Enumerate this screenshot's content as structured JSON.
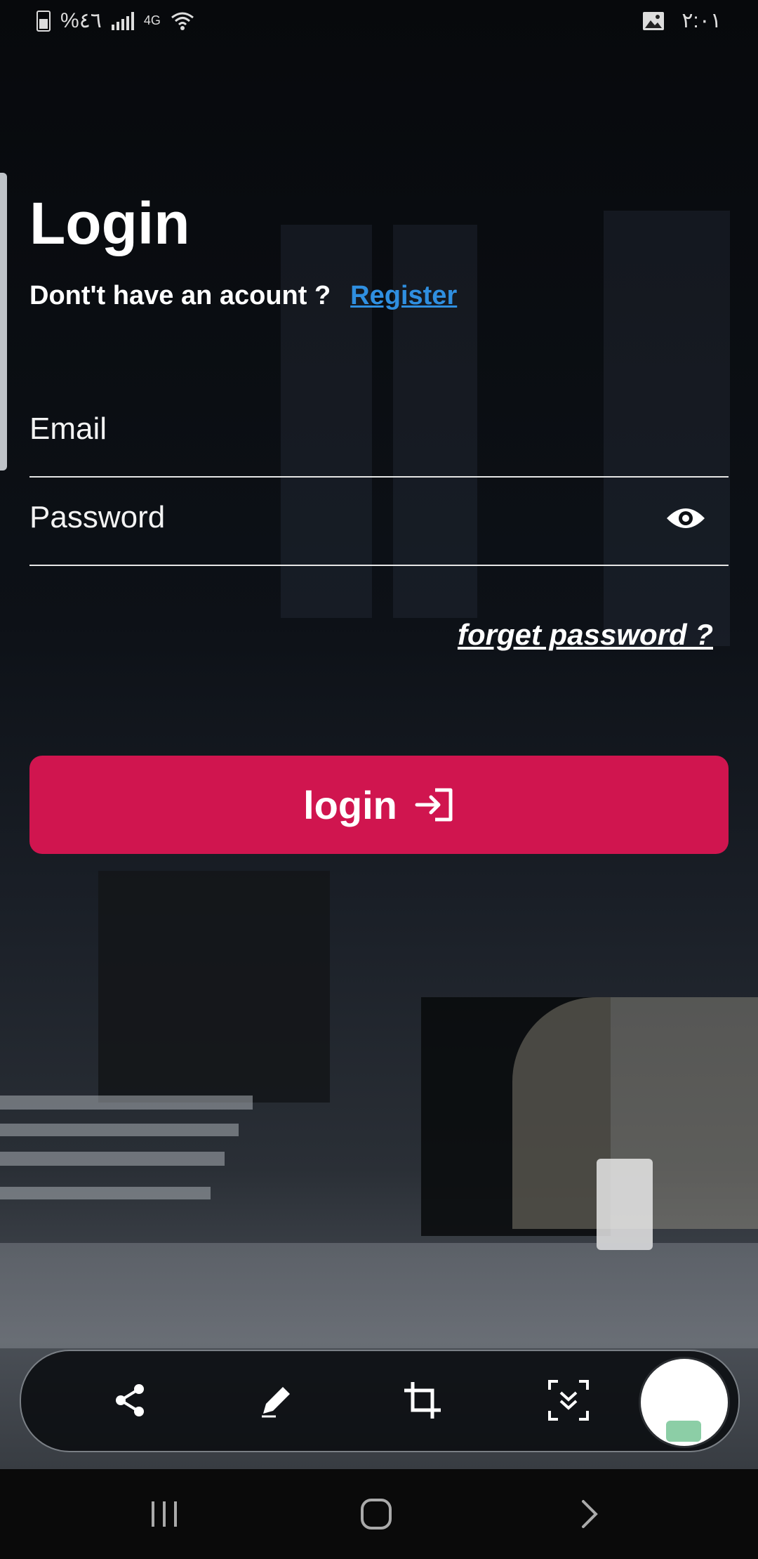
{
  "status_bar": {
    "battery_percent": "%٤٦",
    "network_label": "4G",
    "time": "٢:٠١",
    "icons": [
      "battery-icon",
      "signal-icon",
      "wifi-icon",
      "gallery-icon"
    ]
  },
  "login": {
    "title": "Login",
    "signup_prompt": "Dont't have an acount ?",
    "register_link": "Register",
    "email_placeholder": "Email",
    "password_placeholder": "Password",
    "forgot_link": "forget password ?",
    "login_button": "login",
    "login_icon": "login-arrow-icon"
  },
  "colors": {
    "accent": "#d0154f",
    "link": "#2f8fe0"
  },
  "toolbar": {
    "tools": [
      "share-icon",
      "edit-icon",
      "crop-icon",
      "scroll-capture-icon"
    ],
    "thumbnail": "screenshot-thumbnail"
  },
  "navbar": {
    "buttons": [
      "recent-apps-icon",
      "home-icon",
      "back-icon"
    ]
  }
}
